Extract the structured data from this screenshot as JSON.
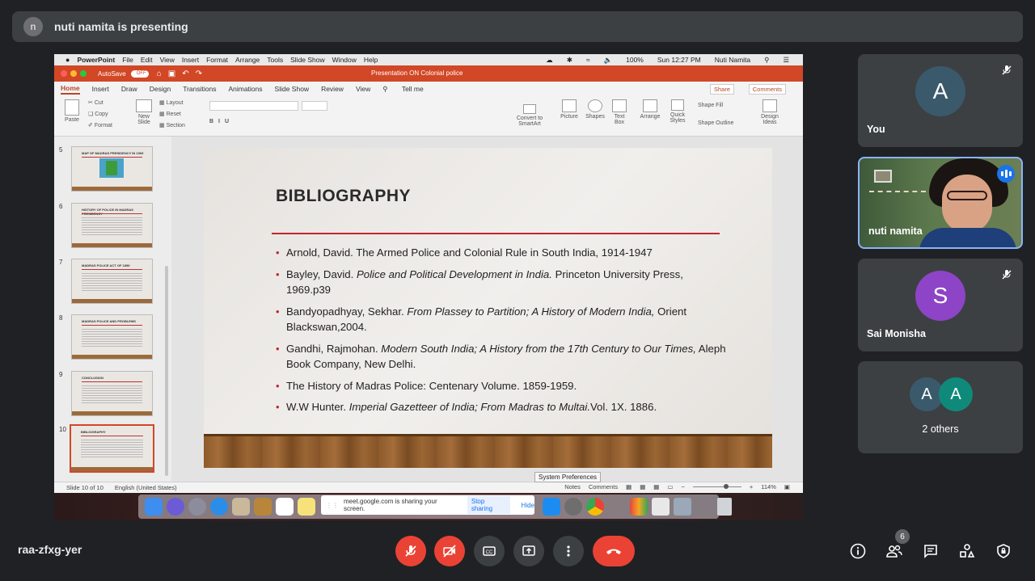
{
  "presenting": {
    "avatar_initial": "n",
    "text": "nuti namita is presenting"
  },
  "mac_menubar": {
    "apple": "",
    "items": [
      "PowerPoint",
      "File",
      "Edit",
      "View",
      "Insert",
      "Format",
      "Arrange",
      "Tools",
      "Slide Show",
      "Window",
      "Help"
    ],
    "battery": "100%",
    "clock": "Sun 12:27 PM",
    "user": "Nuti Namita"
  },
  "ppt_titlebar": {
    "autosave": "AutoSave",
    "toggle": "OFF",
    "document": "Presentation ON Colonial police"
  },
  "ribbon_tabs": {
    "tabs": [
      "Home",
      "Insert",
      "Draw",
      "Design",
      "Transitions",
      "Animations",
      "Slide Show",
      "Review",
      "View"
    ],
    "tell_me": "Tell me",
    "share": "Share",
    "comments": "Comments"
  },
  "ribbon": {
    "paste": "Paste",
    "cut": "Cut",
    "copy": "Copy",
    "format": "Format",
    "new_slide": "New Slide",
    "layout": "Layout",
    "reset": "Reset",
    "section": "Section",
    "convert": "Convert to SmartArt",
    "picture": "Picture",
    "shapes": "Shapes",
    "textbox": "Text Box",
    "arrange": "Arrange",
    "quick_styles": "Quick Styles",
    "shape_fill": "Shape Fill",
    "shape_outline": "Shape Outline",
    "design_ideas": "Design Ideas"
  },
  "thumbnails": [
    {
      "num": "5",
      "title": "MAP OF MADRAS PRESIDENCY IN 1909"
    },
    {
      "num": "6",
      "title": "HISTORY OF POLICE IN MADRAS PRESIDENCY"
    },
    {
      "num": "7",
      "title": "MADRAS POLICE ACT OF 1859"
    },
    {
      "num": "8",
      "title": "MADRAS POLICE AND PROBLEMS"
    },
    {
      "num": "9",
      "title": "CONCLUSION"
    },
    {
      "num": "10",
      "title": "BIBLIOGRAPHY"
    }
  ],
  "slide": {
    "title": "BIBLIOGRAPHY",
    "entries": [
      {
        "plain": "Arnold, David. The Armed Police and Colonial Rule in South India, 1914-1947",
        "italic": "",
        "tail": ""
      },
      {
        "plain": "Bayley, David. ",
        "italic": "Police and Political Development in India.",
        "tail": " Princeton University Press, 1969.p39"
      },
      {
        "plain": "Bandyopadhyay, Sekhar. ",
        "italic": "From Plassey to Partition; A History of Modern India,",
        "tail": " Orient Blackswan,2004."
      },
      {
        "plain": "Gandhi, Rajmohan. ",
        "italic": "Modern South India; A History from the 17th Century to Our Times,",
        "tail": " Aleph Book Company, New Delhi."
      },
      {
        "plain": "The History of Madras Police: Centenary Volume. 1859-1959.",
        "italic": "",
        "tail": ""
      },
      {
        "plain": "W.W Hunter. ",
        "italic": "Imperial Gazetteer of India; From Madras to Multai.",
        "tail": "Vol. 1X. 1886."
      }
    ]
  },
  "statusbar": {
    "slide_count": "Slide 10 of 10",
    "language": "English (United States)",
    "notes": "Notes",
    "comments": "Comments",
    "zoom": "114%"
  },
  "tooltip": "System Preferences",
  "share_banner": {
    "text": "meet.google.com is sharing your screen.",
    "stop": "Stop sharing",
    "hide": "Hide"
  },
  "participants": [
    {
      "name": "You",
      "initial": "A",
      "color": "#3a5a6c"
    },
    {
      "name": "nuti namita"
    },
    {
      "name": "Sai Monisha",
      "initial": "S",
      "color": "#8e44c6"
    },
    {
      "name": "2 others",
      "initials": [
        "A",
        "A"
      ],
      "colors": [
        "#3a5a6c",
        "#0f8a7a"
      ]
    }
  ],
  "meeting_code": "raa-zfxg-yer",
  "people_count": "6",
  "colors": {
    "bg": "#202124",
    "tile": "#3c4043",
    "red": "#ea4335",
    "ppt_orange": "#d24726"
  }
}
